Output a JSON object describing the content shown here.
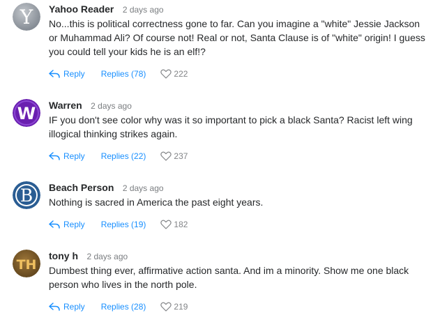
{
  "comments": [
    {
      "author": "Yahoo Reader",
      "time": "2 days ago",
      "text": "No...this is political correctness gone to far. Can you imagine a \"white\" Jessie Jackson or Muhammad Ali? Of course not! Real or not, Santa Clause is of \"white\" origin! I guess you could tell your kids he is an elf!?",
      "reply_label": "Reply",
      "replies_label": "Replies (78)",
      "likes": "222",
      "avatar": {
        "letter": "Y",
        "bg": "#9aa0a8",
        "fg": "#ffffff"
      }
    },
    {
      "author": "Warren",
      "time": "2 days ago",
      "text": "IF you don't see color why was it so important to pick a black Santa? Racist left wing illogical thinking strikes again.",
      "reply_label": "Reply",
      "replies_label": "Replies (22)",
      "likes": "237",
      "avatar": {
        "letter": "W",
        "bg": "#6a1fb0",
        "fg": "#ffffff"
      }
    },
    {
      "author": "Beach Person",
      "time": "2 days ago",
      "text": "Nothing is sacred in America the past eight years.",
      "reply_label": "Reply",
      "replies_label": "Replies (19)",
      "likes": "182",
      "avatar": {
        "letter": "B",
        "bg": "#2a5d93",
        "fg": "#ffffff"
      }
    },
    {
      "author": "tony h",
      "time": "2 days ago",
      "text": "Dumbest thing ever, affirmative action santa. And im a minority. Show me one black person who lives in the north pole.",
      "reply_label": "Reply",
      "replies_label": "Replies (28)",
      "likes": "219",
      "avatar": {
        "letter": "TH",
        "bg": "#7a5a2a",
        "fg": "#f0c060"
      }
    }
  ],
  "colors": {
    "link": "#188fff",
    "meta": "#7a7d80",
    "text": "#26282a"
  },
  "icons": {
    "reply": "reply-arrow-icon",
    "like": "heart-outline-icon"
  }
}
